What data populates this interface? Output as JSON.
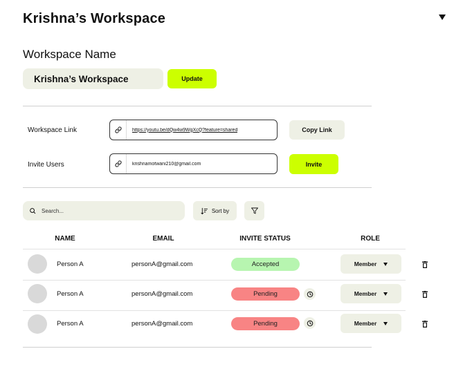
{
  "workspace": {
    "title": "Krishna’s Workspace",
    "name_section_label": "Workspace Name",
    "name_value": "Krishna’s Workspace",
    "update_label": "Update"
  },
  "link": {
    "label": "Workspace Link",
    "url": "https://youtu.be/dQw4w9WgXcQ?feature=shared",
    "copy_label": "Copy Link"
  },
  "invite": {
    "label": "Invite Users",
    "email": "krishnamotwani210@gmail.com",
    "invite_label": "Invite"
  },
  "toolbar": {
    "search_placeholder": "Search...",
    "sort_label": "Sort by"
  },
  "table": {
    "headers": [
      "NAME",
      "EMAIL",
      "INVITE STATUS",
      "ROLE"
    ],
    "rows": [
      {
        "name": "Person A",
        "email": "personA@gmail.com",
        "status": "Accepted",
        "role": "Member"
      },
      {
        "name": "Person A",
        "email": "personA@gmail.com",
        "status": "Pending",
        "role": "Member"
      },
      {
        "name": "Person A",
        "email": "personA@gmail.com",
        "status": "Pending",
        "role": "Member"
      }
    ]
  },
  "colors": {
    "accent": "#ccff00",
    "field_bg": "#eef0e5",
    "accepted": "#b7f5b0",
    "pending": "#f88484"
  },
  "icons": {
    "workspace_toggle": "caret-down-icon",
    "link": "link-icon",
    "search": "search-icon",
    "sort": "sort-icon",
    "filter": "filter-icon",
    "resend": "clock-icon",
    "role_dropdown": "caret-down-icon",
    "delete": "trash-icon"
  }
}
